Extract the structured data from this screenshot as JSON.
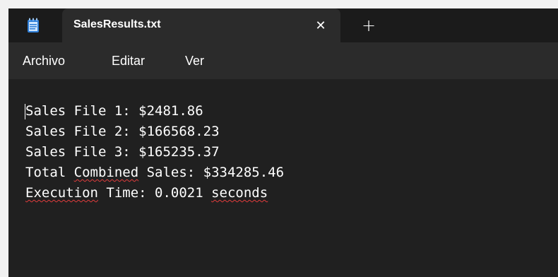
{
  "tab": {
    "icon": "notepad-icon",
    "title": "SalesResults.txt",
    "close_label": "✕",
    "new_tab_label": "+"
  },
  "menu": {
    "items": [
      "Archivo",
      "Editar",
      "Ver"
    ]
  },
  "document": {
    "lines": [
      [
        {
          "t": "Sales File 1: $2481.86"
        }
      ],
      [
        {
          "t": "Sales File 2: $166568.23"
        }
      ],
      [
        {
          "t": "Sales File 3: $165235.37"
        }
      ],
      [
        {
          "t": "Total "
        },
        {
          "t": "Combined",
          "spell": true
        },
        {
          "t": " Sales: $334285.46"
        }
      ],
      [
        {
          "t": "Execution",
          "spell": true
        },
        {
          "t": " Time: 0.0021 "
        },
        {
          "t": "seconds",
          "spell": true
        }
      ]
    ]
  },
  "colors": {
    "titlebar_bg": "#1b1b1b",
    "tab_bg": "#2b2b2b",
    "editor_bg": "#202020",
    "text": "#ffffff",
    "spellcheck_underline": "#e23c3c",
    "icon_blue": "#2f7fd8"
  }
}
